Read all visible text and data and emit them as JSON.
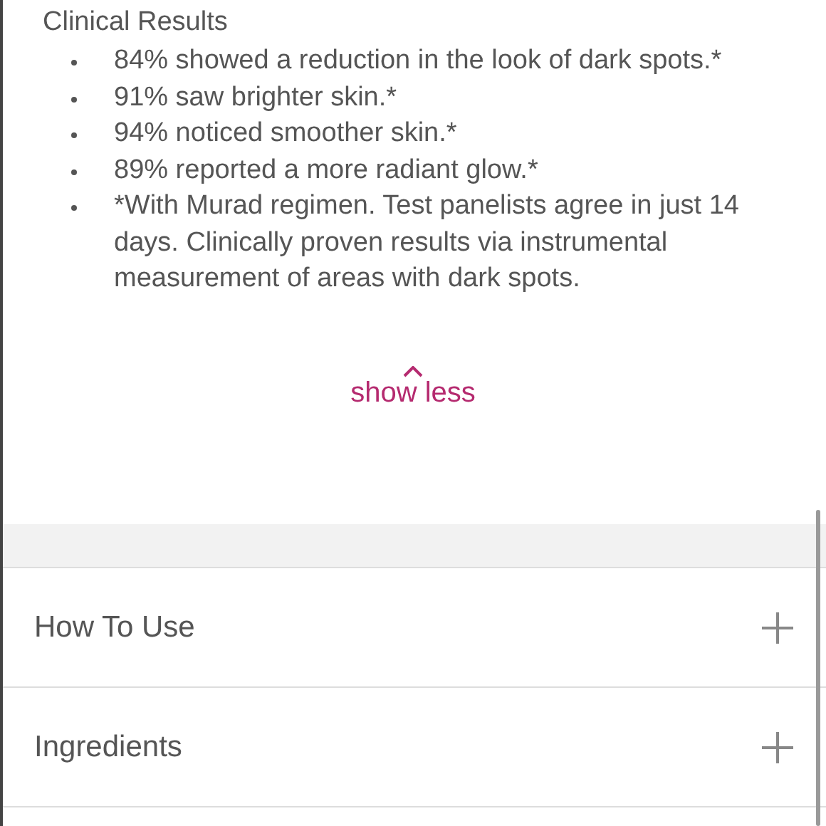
{
  "section": {
    "title": "Clinical Results",
    "bullets": [
      "84% showed a reduction in the look of dark spots.*",
      "91% saw brighter skin.*",
      "94% noticed smoother skin.*",
      "89% reported a more radiant glow.*",
      "*With Murad regimen. Test panelists agree in just 14 days. Clinically proven results via instrumental measurement of areas with dark spots."
    ]
  },
  "toggle": {
    "label": "show less"
  },
  "accordion": [
    {
      "label": "How To Use",
      "expanded": false
    },
    {
      "label": "Ingredients",
      "expanded": false
    }
  ]
}
